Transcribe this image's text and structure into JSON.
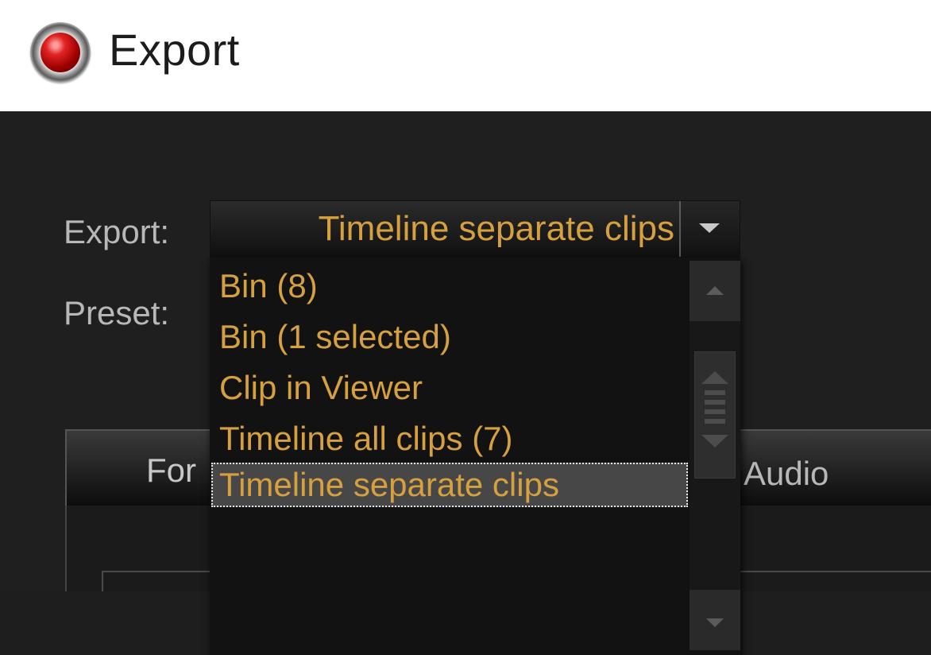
{
  "window": {
    "title": "Export",
    "icon": "red-record-icon"
  },
  "form": {
    "export_label": "Export:",
    "preset_label": "Preset:",
    "export_value": "Timeline separate clips"
  },
  "dropdown": {
    "options": [
      "Bin (8)",
      "Bin (1 selected)",
      "Clip in Viewer",
      "Timeline all clips (7)",
      "Timeline separate clips"
    ],
    "selected_index": 4
  },
  "tabs": {
    "format_partial": "For",
    "audio": "Audio"
  },
  "colors": {
    "accent": "#d6a03f",
    "background": "#1f1f1f",
    "label": "#b8b8b8"
  }
}
